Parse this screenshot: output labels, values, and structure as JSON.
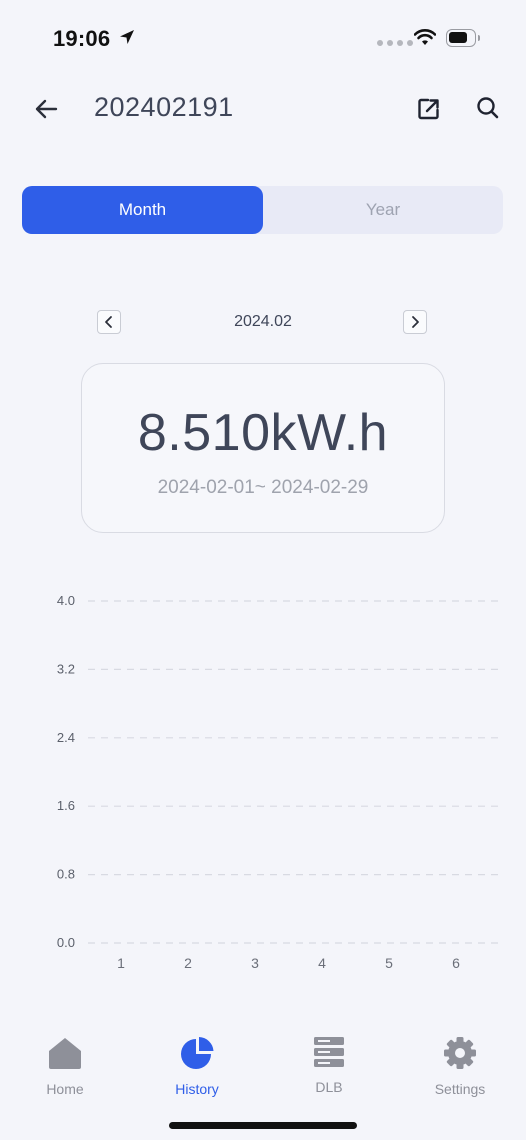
{
  "status_bar": {
    "time": "19:06"
  },
  "header": {
    "title": "202402191"
  },
  "segments": {
    "month": "Month",
    "year": "Year",
    "active": "Month"
  },
  "period_nav": {
    "period": "2024.02"
  },
  "summary": {
    "energy": "8.510kW.h",
    "range": "2024-02-01~ 2024-02-29"
  },
  "chart_data": {
    "type": "bar",
    "categories": [
      "1",
      "2",
      "3",
      "4",
      "5",
      "6"
    ],
    "values": [
      0,
      0,
      0,
      0,
      0,
      0
    ],
    "y_ticks": [
      "4.0",
      "3.2",
      "2.4",
      "1.6",
      "0.8",
      "0.0"
    ],
    "ylim": [
      0,
      4.0
    ],
    "grid": true,
    "title": "",
    "xlabel": "",
    "ylabel": ""
  },
  "tabs": [
    {
      "label": "Home",
      "icon": "home-icon",
      "active": false
    },
    {
      "label": "History",
      "icon": "pie-chart-icon",
      "active": true
    },
    {
      "label": "DLB",
      "icon": "server-icon",
      "active": false
    },
    {
      "label": "Settings",
      "icon": "gear-icon",
      "active": false
    }
  ],
  "colors": {
    "accent": "#2f5ee8",
    "inactive": "#8e9099",
    "background": "#f4f5fa"
  }
}
